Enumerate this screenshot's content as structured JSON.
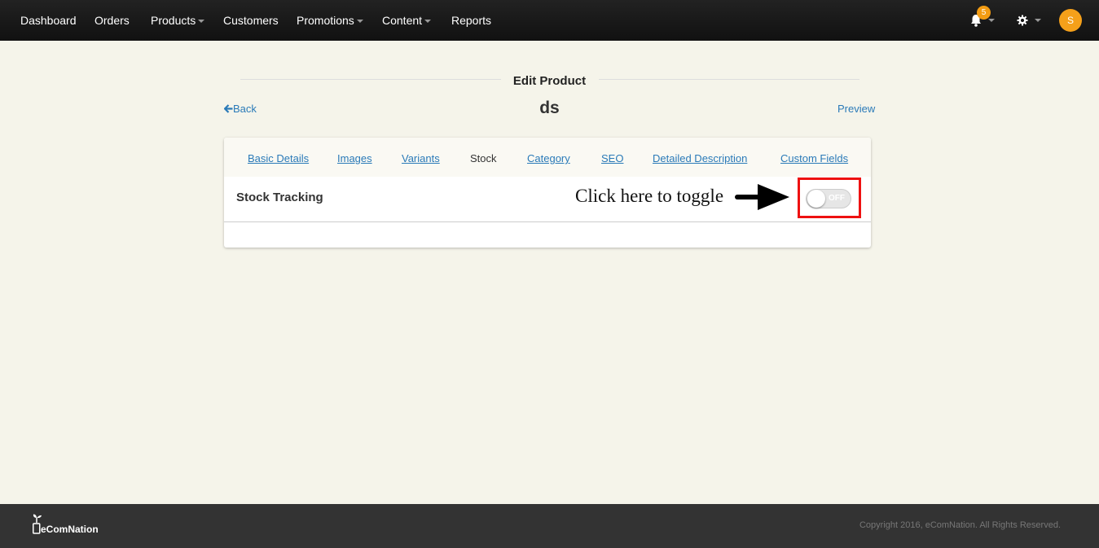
{
  "nav": {
    "items": [
      {
        "label": "Dashboard",
        "dropdown": false
      },
      {
        "label": "Orders",
        "dropdown": false
      },
      {
        "label": "Products",
        "dropdown": true
      },
      {
        "label": "Customers",
        "dropdown": false
      },
      {
        "label": "Promotions",
        "dropdown": true
      },
      {
        "label": "Content",
        "dropdown": true
      },
      {
        "label": "Reports",
        "dropdown": false
      }
    ],
    "notification_count": "5",
    "avatar_initial": "S"
  },
  "page": {
    "title": "Edit Product",
    "back_label": "Back",
    "product_name": "ds",
    "preview_label": "Preview"
  },
  "tabs": [
    {
      "label": "Basic Details",
      "active": false
    },
    {
      "label": "Images",
      "active": false
    },
    {
      "label": "Variants",
      "active": false
    },
    {
      "label": "Stock",
      "active": true
    },
    {
      "label": "Category",
      "active": false
    },
    {
      "label": "SEO",
      "active": false
    },
    {
      "label": "Detailed Description",
      "active": false
    },
    {
      "label": "Custom Fields",
      "active": false
    }
  ],
  "stock": {
    "label": "Stock Tracking",
    "toggle_state": "OFF",
    "annotation": "Click here to toggle"
  },
  "footer": {
    "brand": "eComNation",
    "copyright": "Copyright 2016, eComNation. All Rights Reserved."
  },
  "colors": {
    "accent_link": "#2a7ab8",
    "highlight": "#e11",
    "badge": "#f39c12"
  }
}
